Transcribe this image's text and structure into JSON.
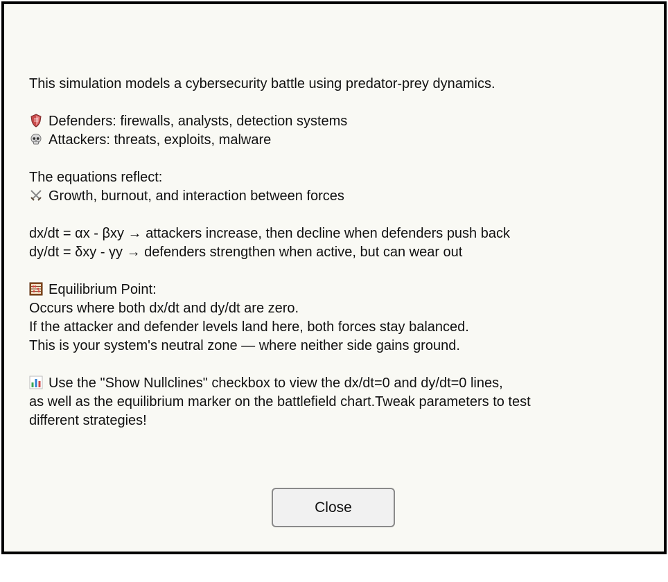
{
  "intro": "This simulation models a cybersecurity battle using predator-prey dynamics.",
  "roles": {
    "defenders": {
      "icon": "shield-icon",
      "text": "Defenders: firewalls, analysts, detection systems"
    },
    "attackers": {
      "icon": "skull-icon",
      "text": "Attackers: threats, exploits, malware"
    }
  },
  "equations": {
    "heading": "The equations reflect:",
    "summary": {
      "icon": "crossed-swords-icon",
      "text": "Growth, burnout, and interaction between forces"
    },
    "dx": "dx/dt = αx - βxy → attackers increase, then decline when defenders push back",
    "dy": "dy/dt = δxy - γy → defenders strengthen when active, but can wear out"
  },
  "equilibrium": {
    "icon": "abacus-icon",
    "heading": "Equilibrium Point:",
    "line1": "Occurs where both dx/dt and dy/dt are zero.",
    "line2": "If the attacker and defender levels land here, both forces stay balanced.",
    "line3": "This is your system's neutral zone — where neither side gains ground."
  },
  "tip": {
    "icon": "bar-chart-icon",
    "line1": "Use the \"Show Nullclines\" checkbox to view the dx/dt=0 and dy/dt=0 lines,",
    "line2": "as well as the equilibrium marker on the battlefield chart.Tweak parameters to test",
    "line3": "different strategies!"
  },
  "close_label": "Close",
  "colors": {
    "dialog_background": "#f9f9f4",
    "border": "#000000",
    "button_background": "#f1f1f1"
  }
}
